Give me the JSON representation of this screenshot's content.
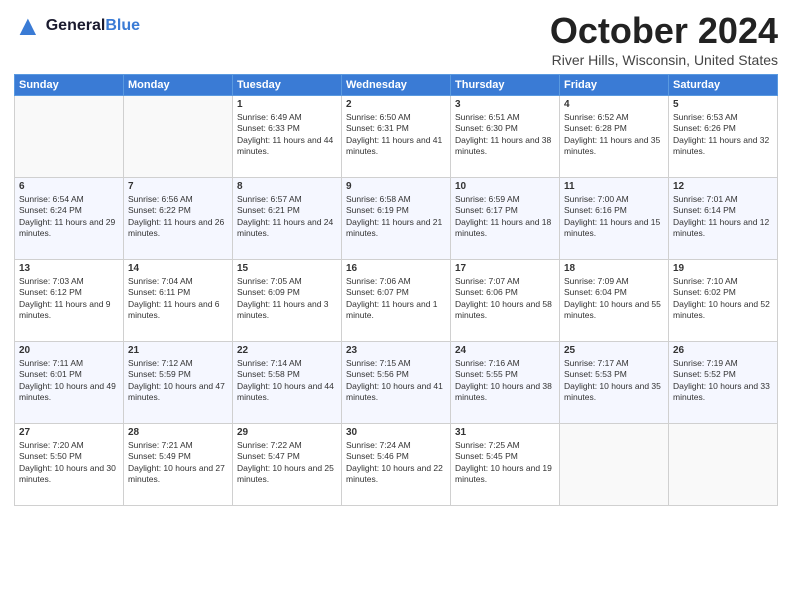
{
  "header": {
    "logo_general": "General",
    "logo_blue": "Blue",
    "month_title": "October 2024",
    "subtitle": "River Hills, Wisconsin, United States"
  },
  "days_of_week": [
    "Sunday",
    "Monday",
    "Tuesday",
    "Wednesday",
    "Thursday",
    "Friday",
    "Saturday"
  ],
  "weeks": [
    [
      {
        "day": "",
        "sunrise": "",
        "sunset": "",
        "daylight": ""
      },
      {
        "day": "",
        "sunrise": "",
        "sunset": "",
        "daylight": ""
      },
      {
        "day": "1",
        "sunrise": "Sunrise: 6:49 AM",
        "sunset": "Sunset: 6:33 PM",
        "daylight": "Daylight: 11 hours and 44 minutes."
      },
      {
        "day": "2",
        "sunrise": "Sunrise: 6:50 AM",
        "sunset": "Sunset: 6:31 PM",
        "daylight": "Daylight: 11 hours and 41 minutes."
      },
      {
        "day": "3",
        "sunrise": "Sunrise: 6:51 AM",
        "sunset": "Sunset: 6:30 PM",
        "daylight": "Daylight: 11 hours and 38 minutes."
      },
      {
        "day": "4",
        "sunrise": "Sunrise: 6:52 AM",
        "sunset": "Sunset: 6:28 PM",
        "daylight": "Daylight: 11 hours and 35 minutes."
      },
      {
        "day": "5",
        "sunrise": "Sunrise: 6:53 AM",
        "sunset": "Sunset: 6:26 PM",
        "daylight": "Daylight: 11 hours and 32 minutes."
      }
    ],
    [
      {
        "day": "6",
        "sunrise": "Sunrise: 6:54 AM",
        "sunset": "Sunset: 6:24 PM",
        "daylight": "Daylight: 11 hours and 29 minutes."
      },
      {
        "day": "7",
        "sunrise": "Sunrise: 6:56 AM",
        "sunset": "Sunset: 6:22 PM",
        "daylight": "Daylight: 11 hours and 26 minutes."
      },
      {
        "day": "8",
        "sunrise": "Sunrise: 6:57 AM",
        "sunset": "Sunset: 6:21 PM",
        "daylight": "Daylight: 11 hours and 24 minutes."
      },
      {
        "day": "9",
        "sunrise": "Sunrise: 6:58 AM",
        "sunset": "Sunset: 6:19 PM",
        "daylight": "Daylight: 11 hours and 21 minutes."
      },
      {
        "day": "10",
        "sunrise": "Sunrise: 6:59 AM",
        "sunset": "Sunset: 6:17 PM",
        "daylight": "Daylight: 11 hours and 18 minutes."
      },
      {
        "day": "11",
        "sunrise": "Sunrise: 7:00 AM",
        "sunset": "Sunset: 6:16 PM",
        "daylight": "Daylight: 11 hours and 15 minutes."
      },
      {
        "day": "12",
        "sunrise": "Sunrise: 7:01 AM",
        "sunset": "Sunset: 6:14 PM",
        "daylight": "Daylight: 11 hours and 12 minutes."
      }
    ],
    [
      {
        "day": "13",
        "sunrise": "Sunrise: 7:03 AM",
        "sunset": "Sunset: 6:12 PM",
        "daylight": "Daylight: 11 hours and 9 minutes."
      },
      {
        "day": "14",
        "sunrise": "Sunrise: 7:04 AM",
        "sunset": "Sunset: 6:11 PM",
        "daylight": "Daylight: 11 hours and 6 minutes."
      },
      {
        "day": "15",
        "sunrise": "Sunrise: 7:05 AM",
        "sunset": "Sunset: 6:09 PM",
        "daylight": "Daylight: 11 hours and 3 minutes."
      },
      {
        "day": "16",
        "sunrise": "Sunrise: 7:06 AM",
        "sunset": "Sunset: 6:07 PM",
        "daylight": "Daylight: 11 hours and 1 minute."
      },
      {
        "day": "17",
        "sunrise": "Sunrise: 7:07 AM",
        "sunset": "Sunset: 6:06 PM",
        "daylight": "Daylight: 10 hours and 58 minutes."
      },
      {
        "day": "18",
        "sunrise": "Sunrise: 7:09 AM",
        "sunset": "Sunset: 6:04 PM",
        "daylight": "Daylight: 10 hours and 55 minutes."
      },
      {
        "day": "19",
        "sunrise": "Sunrise: 7:10 AM",
        "sunset": "Sunset: 6:02 PM",
        "daylight": "Daylight: 10 hours and 52 minutes."
      }
    ],
    [
      {
        "day": "20",
        "sunrise": "Sunrise: 7:11 AM",
        "sunset": "Sunset: 6:01 PM",
        "daylight": "Daylight: 10 hours and 49 minutes."
      },
      {
        "day": "21",
        "sunrise": "Sunrise: 7:12 AM",
        "sunset": "Sunset: 5:59 PM",
        "daylight": "Daylight: 10 hours and 47 minutes."
      },
      {
        "day": "22",
        "sunrise": "Sunrise: 7:14 AM",
        "sunset": "Sunset: 5:58 PM",
        "daylight": "Daylight: 10 hours and 44 minutes."
      },
      {
        "day": "23",
        "sunrise": "Sunrise: 7:15 AM",
        "sunset": "Sunset: 5:56 PM",
        "daylight": "Daylight: 10 hours and 41 minutes."
      },
      {
        "day": "24",
        "sunrise": "Sunrise: 7:16 AM",
        "sunset": "Sunset: 5:55 PM",
        "daylight": "Daylight: 10 hours and 38 minutes."
      },
      {
        "day": "25",
        "sunrise": "Sunrise: 7:17 AM",
        "sunset": "Sunset: 5:53 PM",
        "daylight": "Daylight: 10 hours and 35 minutes."
      },
      {
        "day": "26",
        "sunrise": "Sunrise: 7:19 AM",
        "sunset": "Sunset: 5:52 PM",
        "daylight": "Daylight: 10 hours and 33 minutes."
      }
    ],
    [
      {
        "day": "27",
        "sunrise": "Sunrise: 7:20 AM",
        "sunset": "Sunset: 5:50 PM",
        "daylight": "Daylight: 10 hours and 30 minutes."
      },
      {
        "day": "28",
        "sunrise": "Sunrise: 7:21 AM",
        "sunset": "Sunset: 5:49 PM",
        "daylight": "Daylight: 10 hours and 27 minutes."
      },
      {
        "day": "29",
        "sunrise": "Sunrise: 7:22 AM",
        "sunset": "Sunset: 5:47 PM",
        "daylight": "Daylight: 10 hours and 25 minutes."
      },
      {
        "day": "30",
        "sunrise": "Sunrise: 7:24 AM",
        "sunset": "Sunset: 5:46 PM",
        "daylight": "Daylight: 10 hours and 22 minutes."
      },
      {
        "day": "31",
        "sunrise": "Sunrise: 7:25 AM",
        "sunset": "Sunset: 5:45 PM",
        "daylight": "Daylight: 10 hours and 19 minutes."
      },
      {
        "day": "",
        "sunrise": "",
        "sunset": "",
        "daylight": ""
      },
      {
        "day": "",
        "sunrise": "",
        "sunset": "",
        "daylight": ""
      }
    ]
  ]
}
